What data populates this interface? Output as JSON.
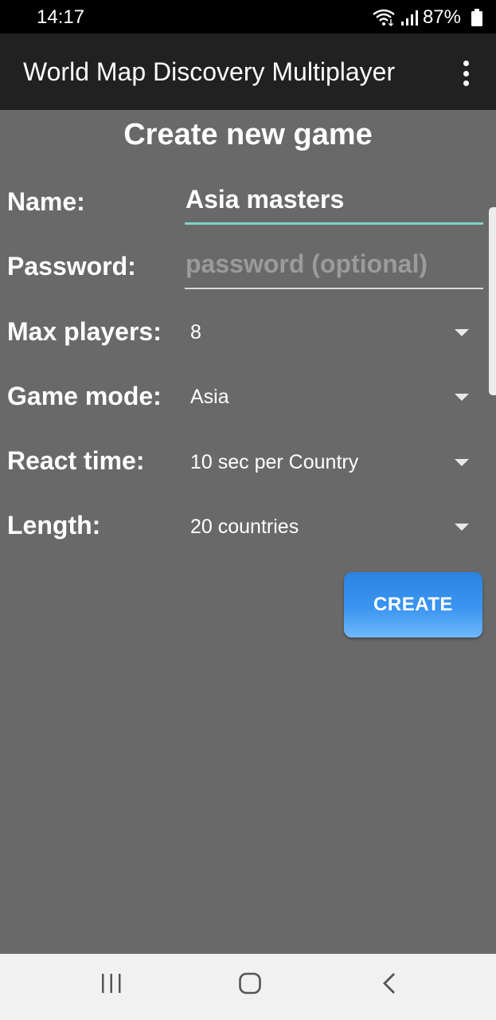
{
  "status_bar": {
    "time": "14:17",
    "battery": "87%",
    "icons": [
      "wifi-icon",
      "signal-icon",
      "battery-icon"
    ]
  },
  "app_bar": {
    "title": "World Map Discovery Multiplayer",
    "menu_icon": "overflow-menu-icon"
  },
  "form": {
    "title": "Create new game",
    "name": {
      "label": "Name:",
      "value": "Asia masters"
    },
    "password": {
      "label": "Password:",
      "placeholder": "password (optional)",
      "value": ""
    },
    "max_players": {
      "label": "Max players:",
      "selected": "8"
    },
    "game_mode": {
      "label": "Game mode:",
      "selected": "Asia"
    },
    "react_time": {
      "label": "React time:",
      "selected": "10 sec per Country"
    },
    "length": {
      "label": "Length:",
      "selected": "20 countries"
    },
    "create_button": "CREATE"
  },
  "colors": {
    "background": "#696969",
    "app_bar": "#212121",
    "focused_underline": "#7fd1c6",
    "button_blue": "#3b95f0",
    "nav_bar": "#f1f1f1"
  },
  "nav_bar": {
    "buttons": [
      "recent-apps-icon",
      "home-icon",
      "back-icon"
    ]
  }
}
